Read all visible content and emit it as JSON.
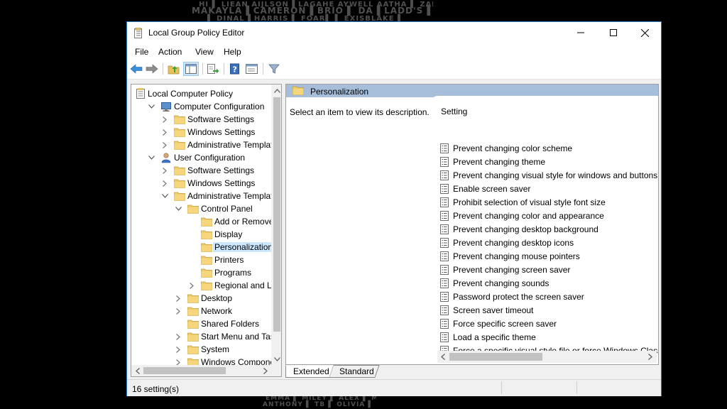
{
  "window": {
    "title": "Local Group Policy Editor",
    "accent": "#2b79d6"
  },
  "menu": [
    "File",
    "Action",
    "View",
    "Help"
  ],
  "toolbar": {
    "icons": [
      "back-arrow-icon",
      "forward-arrow-icon",
      "up-folder-icon",
      "show-hide-tree-icon",
      "export-list-icon",
      "help-icon",
      "properties-icon",
      "filter-icon"
    ]
  },
  "tree": {
    "nodes": [
      {
        "label": "Local Computer Policy",
        "depth": 0,
        "expander": "",
        "icon": "policy-icon"
      },
      {
        "label": "Computer Configuration",
        "depth": 1,
        "expander": "expanded",
        "icon": "computer-icon"
      },
      {
        "label": "Software Settings",
        "depth": 2,
        "expander": "collapsed",
        "icon": "folder-icon"
      },
      {
        "label": "Windows Settings",
        "depth": 2,
        "expander": "collapsed",
        "icon": "folder-icon"
      },
      {
        "label": "Administrative Templates",
        "depth": 2,
        "expander": "collapsed",
        "icon": "folder-icon"
      },
      {
        "label": "User Configuration",
        "depth": 1,
        "expander": "expanded",
        "icon": "user-icon"
      },
      {
        "label": "Software Settings",
        "depth": 2,
        "expander": "collapsed",
        "icon": "folder-icon"
      },
      {
        "label": "Windows Settings",
        "depth": 2,
        "expander": "collapsed",
        "icon": "folder-icon"
      },
      {
        "label": "Administrative Templates",
        "depth": 2,
        "expander": "expanded",
        "icon": "folder-icon"
      },
      {
        "label": "Control Panel",
        "depth": 3,
        "expander": "expanded",
        "icon": "folder-icon"
      },
      {
        "label": "Add or Remove Pr",
        "depth": 4,
        "expander": "",
        "icon": "folder-icon"
      },
      {
        "label": "Display",
        "depth": 4,
        "expander": "",
        "icon": "folder-icon"
      },
      {
        "label": "Personalization",
        "depth": 4,
        "expander": "",
        "icon": "folder-icon",
        "selected": true
      },
      {
        "label": "Printers",
        "depth": 4,
        "expander": "",
        "icon": "folder-icon"
      },
      {
        "label": "Programs",
        "depth": 4,
        "expander": "",
        "icon": "folder-icon"
      },
      {
        "label": "Regional and Lang",
        "depth": 4,
        "expander": "collapsed",
        "icon": "folder-icon"
      },
      {
        "label": "Desktop",
        "depth": 3,
        "expander": "collapsed",
        "icon": "folder-icon"
      },
      {
        "label": "Network",
        "depth": 3,
        "expander": "collapsed",
        "icon": "folder-icon"
      },
      {
        "label": "Shared Folders",
        "depth": 3,
        "expander": "",
        "icon": "folder-icon"
      },
      {
        "label": "Start Menu and Taskb",
        "depth": 3,
        "expander": "collapsed",
        "icon": "folder-icon"
      },
      {
        "label": "System",
        "depth": 3,
        "expander": "collapsed",
        "icon": "folder-icon"
      },
      {
        "label": "Windows Component",
        "depth": 3,
        "expander": "collapsed",
        "icon": "folder-icon"
      }
    ]
  },
  "details": {
    "header_label": "Personalization",
    "header_band_color": "#a6bed9",
    "description": "Select an item to view its description.",
    "column_header": "Setting",
    "settings": [
      "Prevent changing color scheme",
      "Prevent changing theme",
      "Prevent changing visual style for windows and buttons",
      "Enable screen saver",
      "Prohibit selection of visual style font size",
      "Prevent changing color and appearance",
      "Prevent changing desktop background",
      "Prevent changing desktop icons",
      "Prevent changing mouse pointers",
      "Prevent changing screen saver",
      "Prevent changing sounds",
      "Password protect the screen saver",
      "Screen saver timeout",
      "Force specific screen saver",
      "Load a specific theme",
      "Force a specific visual style file or force Windows Classic"
    ]
  },
  "tabs": [
    {
      "label": "Extended",
      "active": true
    },
    {
      "label": "Standard",
      "active": false
    }
  ],
  "status": {
    "text": "16 setting(s)"
  }
}
